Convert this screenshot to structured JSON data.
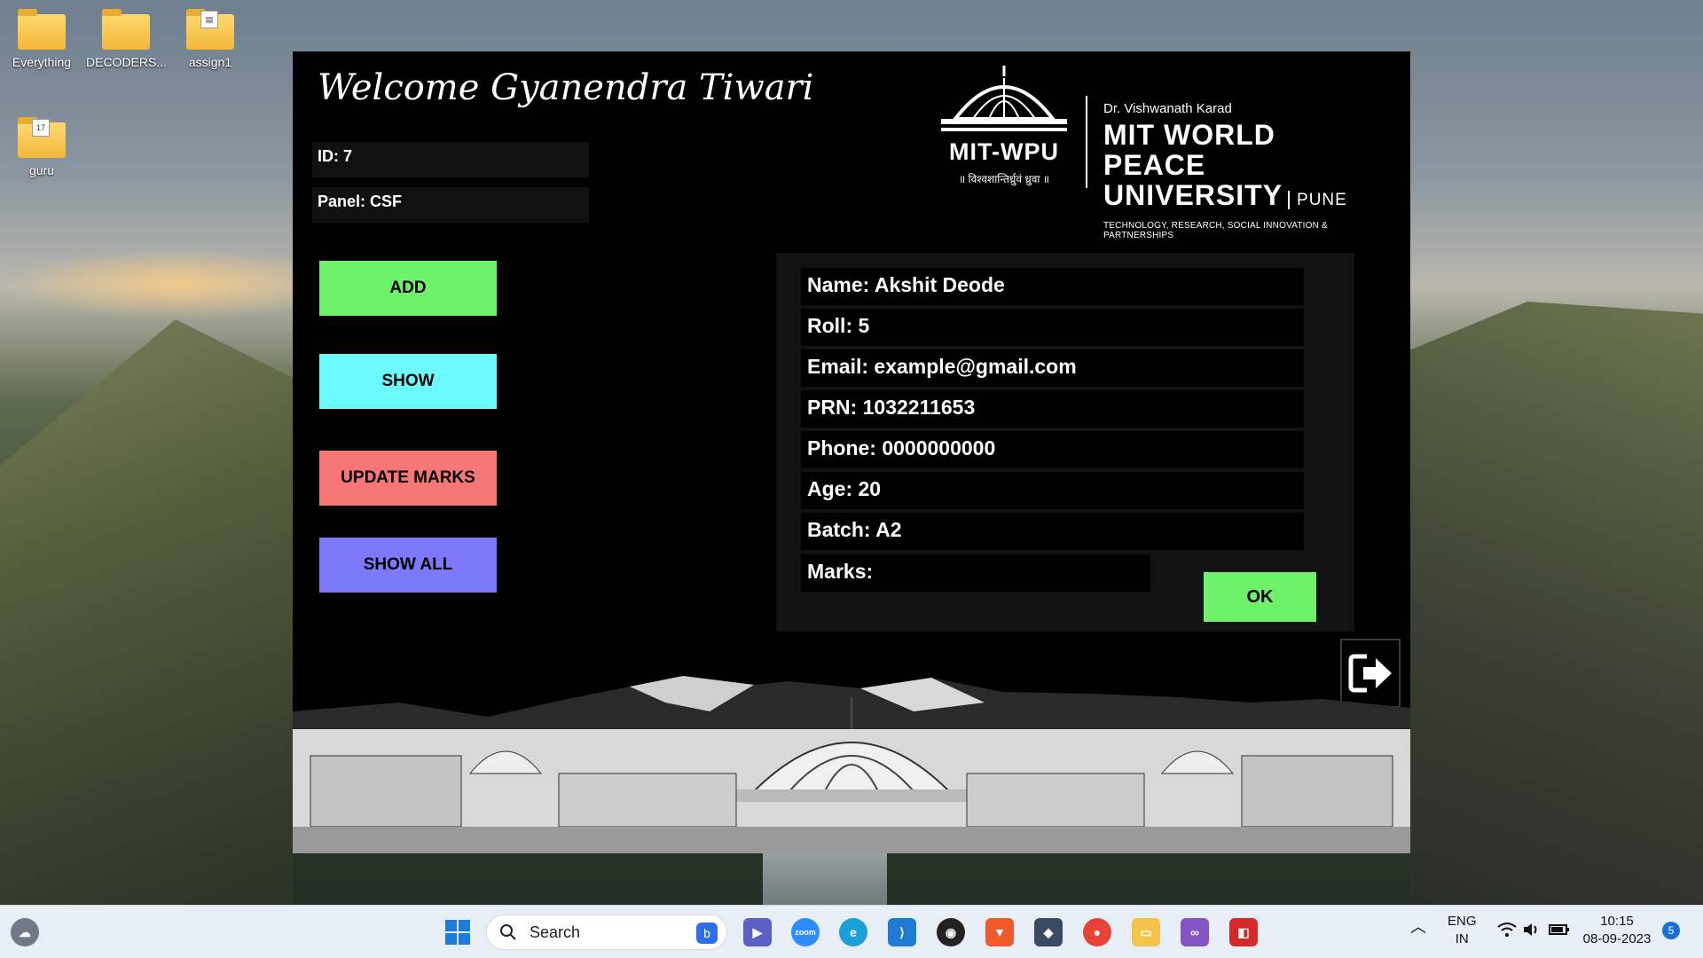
{
  "desktop": {
    "icons": [
      {
        "label": "Everything"
      },
      {
        "label": "DECODERS..."
      },
      {
        "label": "assign1"
      },
      {
        "label": "guru"
      }
    ]
  },
  "app": {
    "welcome": "Welcome Gyanendra Tiwari",
    "id_text": "ID: 7",
    "panel_text": "Panel: CSF",
    "logo": {
      "mitwpu": "MIT-WPU",
      "motto": "॥ विश्वशान्तिर्ध्रुवं ध्रुवा ॥",
      "line1": "Dr. Vishwanath Karad",
      "line2": "MIT WORLD PEACE",
      "line3": "UNIVERSITY",
      "line3b": "PUNE",
      "line4": "TECHNOLOGY, RESEARCH, SOCIAL INNOVATION & PARTNERSHIPS"
    },
    "buttons": {
      "add": "ADD",
      "show": "SHOW",
      "update_marks": "UPDATE MARKS",
      "show_all": "SHOW ALL",
      "ok": "OK"
    },
    "student": {
      "name": "Name: Akshit Deode",
      "roll": "Roll: 5",
      "email": "Email: example@gmail.com",
      "prn": "PRN: 1032211653",
      "phone": "Phone: 0000000000",
      "age": "Age: 20",
      "batch": "Batch: A2",
      "marks": "Marks:"
    },
    "colors": {
      "add": "#6ef26a",
      "show": "#6cfbfc",
      "update": "#f77775",
      "show_all": "#7d79fb"
    }
  },
  "taskbar": {
    "search_label": "Search",
    "lang_line1": "ENG",
    "lang_line2": "IN",
    "time": "10:15",
    "date": "08-09-2023",
    "notification_count": "5",
    "zoom_label": "zoom"
  }
}
